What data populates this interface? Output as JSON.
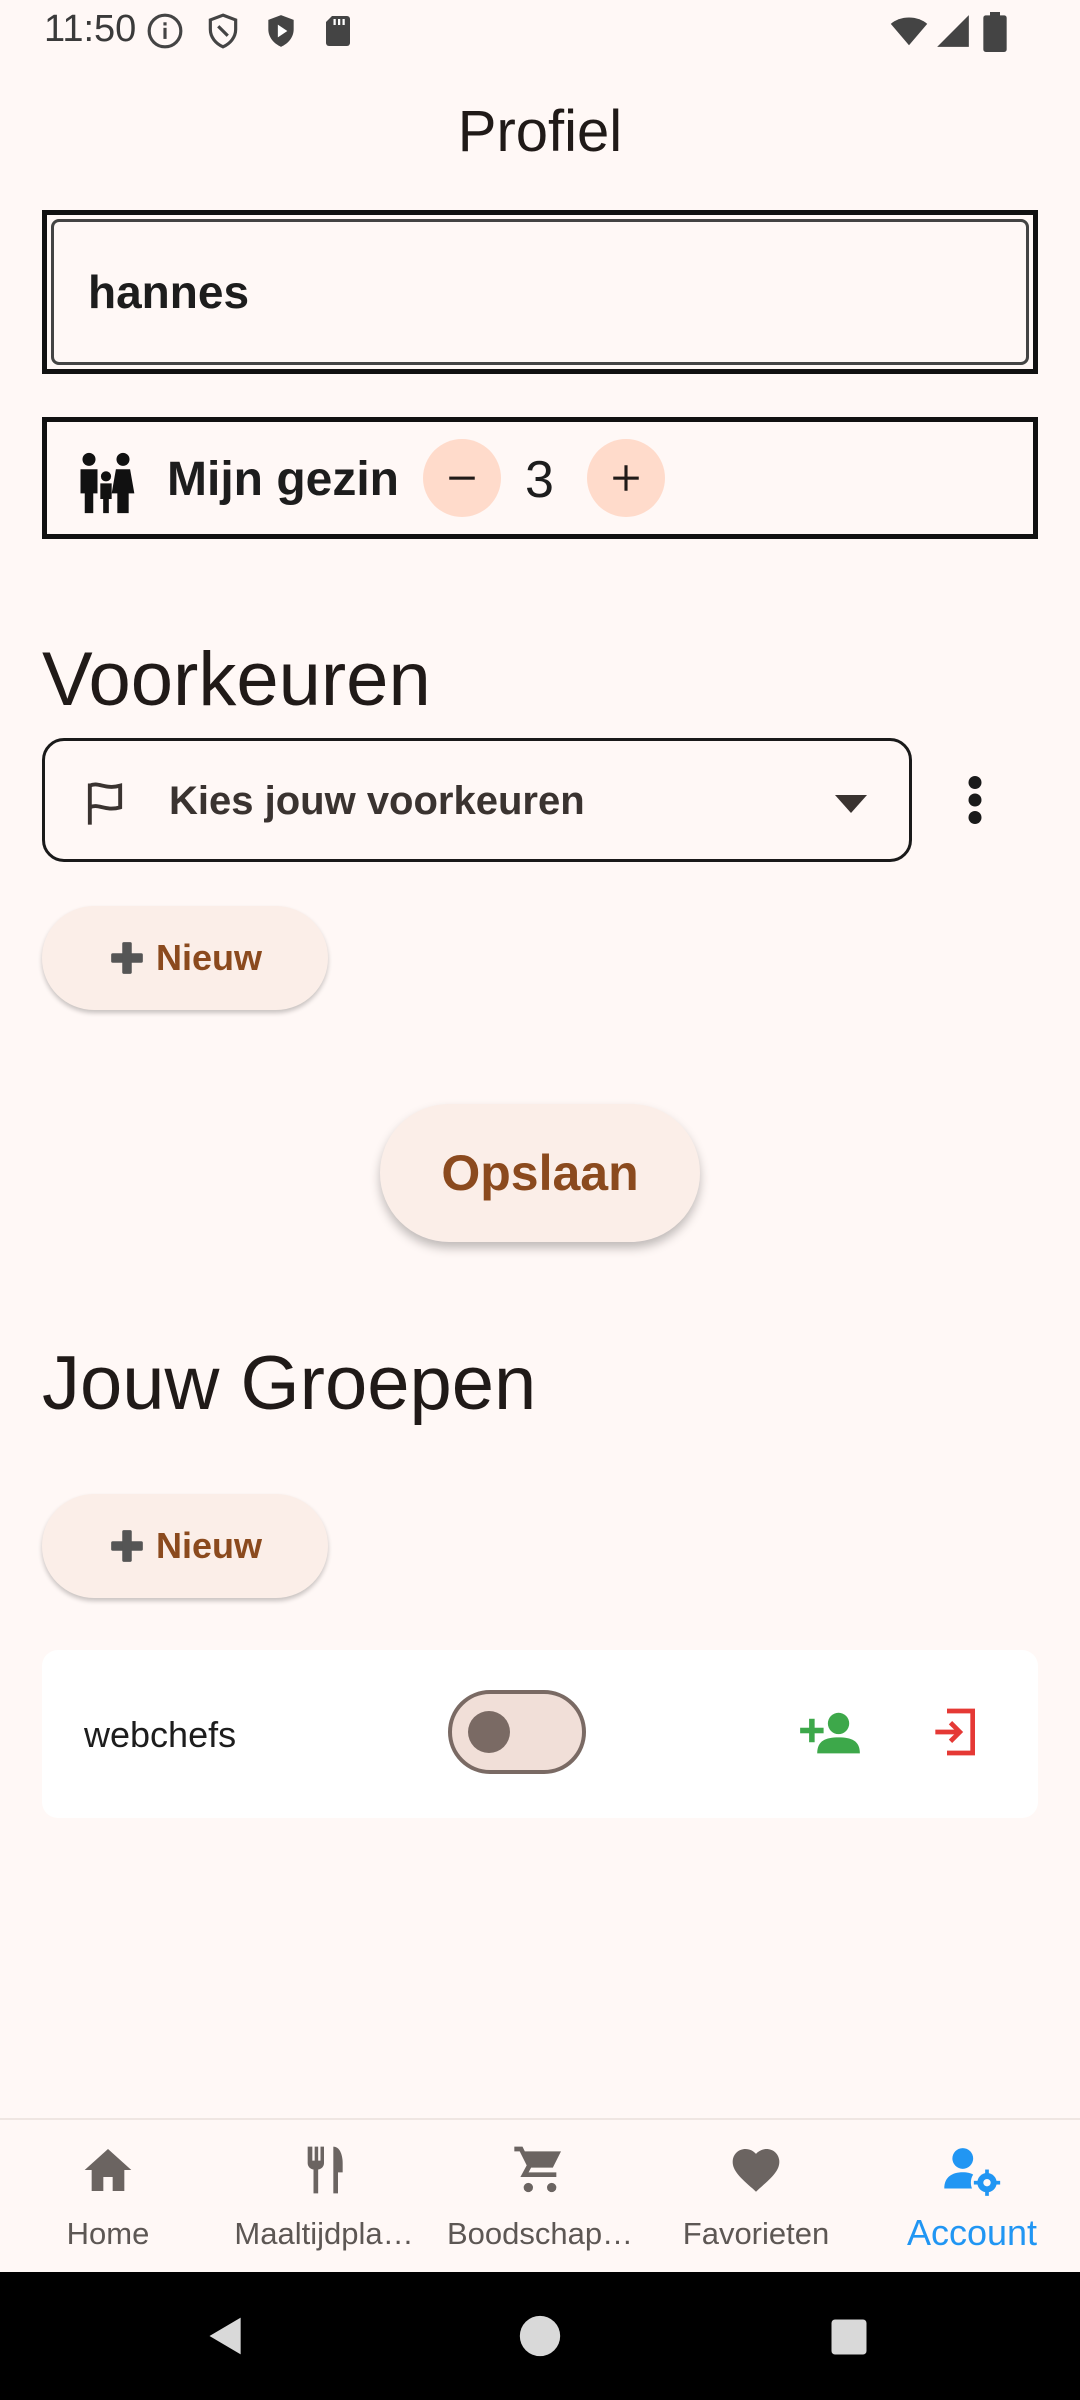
{
  "status_bar": {
    "time": "11:50",
    "icons": [
      "info-icon",
      "shield-icon",
      "play-protect-icon",
      "sd-card-icon",
      "wifi-icon",
      "signal-icon",
      "battery-icon"
    ]
  },
  "page": {
    "title": "Profiel"
  },
  "profile": {
    "name_value": "hannes",
    "family_label": "Mijn gezin",
    "family_count": "3"
  },
  "preferences": {
    "title": "Voorkeuren",
    "dropdown_placeholder": "Kies jouw voorkeuren",
    "new_button_label": "Nieuw"
  },
  "save_button_label": "Opslaan",
  "groups": {
    "title": "Jouw Groepen",
    "new_button_label": "Nieuw",
    "items": [
      {
        "name": "webchefs",
        "enabled": false
      }
    ]
  },
  "bottom_nav": {
    "items": [
      {
        "label": "Home",
        "icon": "home-icon",
        "active": false
      },
      {
        "label": "Maaltijdpla…",
        "icon": "restaurant-icon",
        "active": false
      },
      {
        "label": "Boodschap…",
        "icon": "cart-icon",
        "active": false
      },
      {
        "label": "Favorieten",
        "icon": "heart-icon",
        "active": false
      },
      {
        "label": "Account",
        "icon": "manage-accounts-icon",
        "active": true
      }
    ]
  },
  "colors": {
    "background": "#FFF8F6",
    "accent_brown": "#8B4A1E",
    "active_nav": "#2196F3",
    "add_person_green": "#3DA84A",
    "leave_red": "#E53935",
    "stepper_bg": "#FFDBCB"
  }
}
